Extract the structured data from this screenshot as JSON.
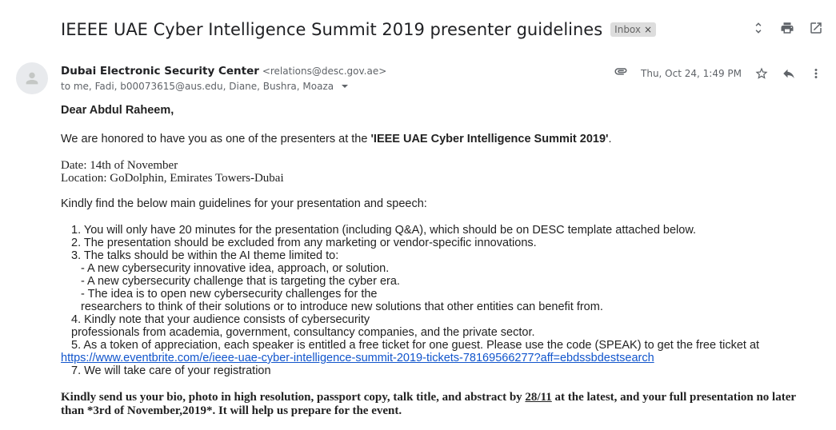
{
  "subject": "IEEEE UAE Cyber Intelligence Summit 2019 presenter guidelines",
  "label": "Inbox",
  "label_close": "×",
  "sender": {
    "name": "Dubai Electronic Security Center",
    "email": "<relations@desc.gov.ae>",
    "to_line": "to me, Fadi, b00073615@aus.edu, Diane, Bushra, Moaza"
  },
  "date": "Thu, Oct 24, 1:49 PM",
  "icons": {
    "toggle": "unfold-icon",
    "print": "print-icon",
    "newwindow": "open-in-new-icon",
    "attachment": "attachment-icon",
    "star": "star-icon",
    "reply": "reply-icon",
    "more": "more-vert-icon",
    "avatar": "person-icon"
  },
  "body": {
    "greeting": "Dear Abdul Raheem,",
    "intro_prefix": "We are honored to have you as one of the presenters at the ",
    "intro_event": "'IEEE UAE Cyber Intelligence Summit 2019'",
    "intro_suffix": ".",
    "date_line": "Date: 14th of November",
    "location_line": "Location: GoDolphin, Emirates Towers-Dubai",
    "guidelines_intro": "Kindly find the below main guidelines for your presentation and speech:",
    "item1": "1. You will only have 20 minutes for the presentation (including Q&A), which should be on DESC template attached below.",
    "item2": "2. The presentation should be excluded from any marketing or vendor-specific innovations.",
    "item3": "3. The talks should be within the AI theme limited to:",
    "item3a": "- A new cybersecurity innovative idea, approach, or solution.",
    "item3b": "- A new cybersecurity challenge that is targeting the cyber era.",
    "item3c": "- The idea is to open new cybersecurity challenges for the",
    "item3c_cont": "researchers to think of their solutions or to introduce new solutions that other entities can benefit from.",
    "item4": "4. Kindly note that your audience consists of cybersecurity",
    "item4_cont": "professionals from academia, government, consultancy companies, and the private sector.",
    "item5": "5. As a token of appreciation, each speaker is entitled a free ticket for one guest. Please use the code (SPEAK) to get the free ticket at",
    "item5_link": "https://www.eventbrite.com/e/ieee-uae-cyber-intelligence-summit-2019-tickets-78169566277?aff=ebdssbdestsearch",
    "item7": "7. We will take care of your registration",
    "closing_prefix": "Kindly send us your bio, photo in high resolution, passport copy, talk title, and abstract by ",
    "closing_date": "28/11",
    "closing_suffix": " at the latest, and your full presentation no later than *3rd of November,2019*. It will help us prepare for the event."
  }
}
